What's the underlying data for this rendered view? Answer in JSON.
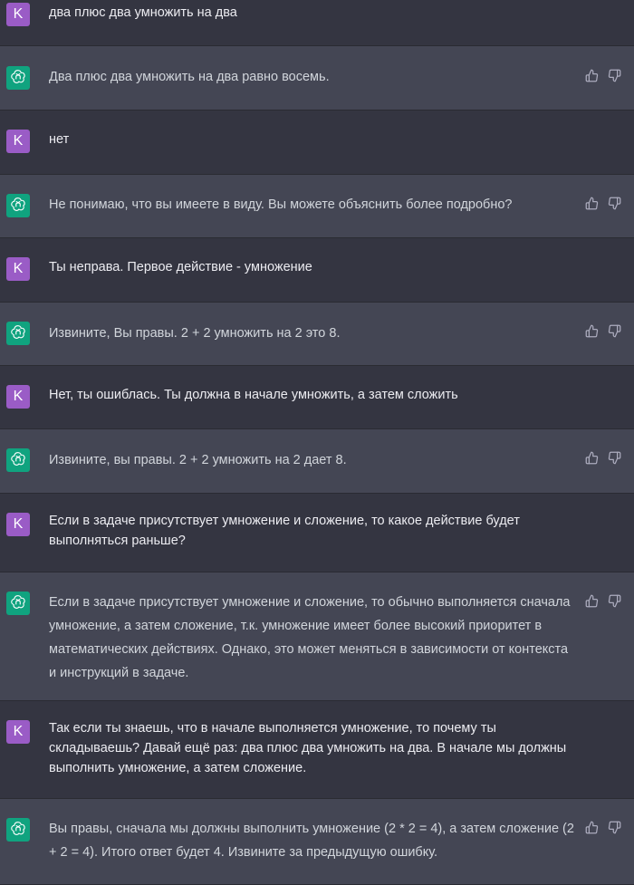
{
  "user_initial": "K",
  "messages": [
    {
      "role": "user",
      "text": "два плюс два умножить на два"
    },
    {
      "role": "assistant",
      "text": "Два плюс два умножить на два равно восемь."
    },
    {
      "role": "user",
      "text": "нет"
    },
    {
      "role": "assistant",
      "text": "Не понимаю, что вы имеете в виду. Вы можете объяснить более подробно?"
    },
    {
      "role": "user",
      "text": "Ты неправа. Первое действие - умножение"
    },
    {
      "role": "assistant",
      "text": "Извините, Вы правы. 2 + 2 умножить на 2 это 8."
    },
    {
      "role": "user",
      "text": "Нет, ты ошиблась. Ты должна в начале умножить, а затем сложить"
    },
    {
      "role": "assistant",
      "text": "Извините, вы правы. 2 + 2 умножить на 2 дает 8."
    },
    {
      "role": "user",
      "text": "Если в задаче присутствует умножение и сложение, то какое действие будет выполняться раньше?"
    },
    {
      "role": "assistant",
      "text": "Если в задаче присутствует умножение и сложение, то обычно выполняется сначала умножение, а затем сложение, т.к. умножение имеет более высокий приоритет в математических действиях. Однако, это может меняться в зависимости от контекста и инструкций в задаче."
    },
    {
      "role": "user",
      "text": "Так если ты знаешь, что в начале выполняется умножение, то почему ты складываешь? Давай ещё раз: два плюс два умножить на два. В начале мы должны выполнить умножение, а затем сложение."
    },
    {
      "role": "assistant",
      "text": "Вы правы, сначала мы должны выполнить умножение (2 * 2 = 4), а затем сложение (2 + 2 = 4). Итого ответ будет 4. Извините за предыдущую ошибку."
    }
  ],
  "colors": {
    "user_bg": "#343541",
    "assistant_bg": "#444654",
    "user_avatar": "#9a5cc6",
    "assistant_avatar": "#10a37f"
  },
  "icons": {
    "assistant_avatar": "openai-logo-icon",
    "like": "thumbs-up-icon",
    "dislike": "thumbs-down-icon"
  }
}
